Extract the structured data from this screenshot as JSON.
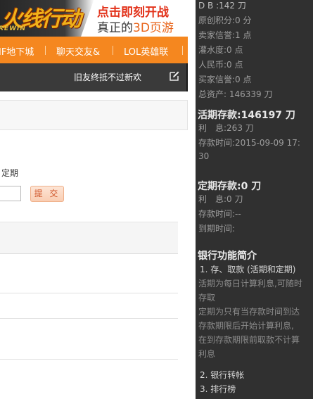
{
  "banner": {
    "logo_text": "火线行动",
    "logo_sub": "REWIN",
    "promo_line1": "点击即刻开战",
    "promo_line2_prefix": "真正的",
    "promo_line2_highlight": "3D页游"
  },
  "nav": {
    "items": [
      "IF地下城",
      "聊天交友&",
      "LOL英雄联"
    ]
  },
  "darkbar": {
    "motto": "旧友终抵不过新欢",
    "edit_icon": "edit-icon"
  },
  "form": {
    "type_label": "定期",
    "amount_value": "",
    "submit_label": "提 交"
  },
  "sidebar": {
    "stats": [
      "D B :142 刀",
      "原创积分:0 分",
      "卖家信誉:1 点",
      "灌水度:0 点",
      "人民币:0 点",
      "买家信誉:0 点",
      "总资产: 146339 刀"
    ],
    "demand": {
      "title": "活期存款:146197 刀",
      "interest": "利　息:263 刀",
      "time_line1": "存款时间:2015-09-09 17:",
      "time_line2": "30"
    },
    "fixed": {
      "title": "定期存款:0 刀",
      "interest": "利　息:0 刀",
      "deposit_time": "存款时间:--",
      "due_time": "到期时间:"
    },
    "intro": {
      "heading": "银行功能简介",
      "item1": "1. 存、取款 (活期和定期)",
      "desc": [
        "活期为每日计算利息,可随时",
        "存取",
        "定期为只有当存款时间到达",
        "存款期限后开始计算利息,",
        "在到存款期限前取款不计算",
        "利息"
      ],
      "item2": "2. 银行转帐",
      "item3": "3. 排行榜"
    }
  },
  "colors": {
    "nav_orange": "#f5871f",
    "sidebar_bg": "#303030",
    "darkbar_bg": "#3a3a3a",
    "submit_text": "#d0562a",
    "promo_red": "#e2321a"
  }
}
